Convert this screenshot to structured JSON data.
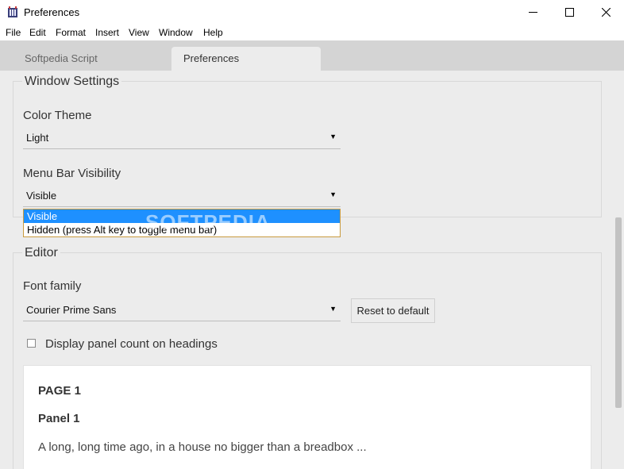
{
  "window": {
    "title": "Preferences"
  },
  "menubar": {
    "items": [
      "File",
      "Edit",
      "Format",
      "Insert",
      "View",
      "Window",
      "Help"
    ]
  },
  "tabs": [
    {
      "label": "Softpedia Script"
    },
    {
      "label": "Preferences"
    }
  ],
  "window_settings": {
    "legend": "Window Settings",
    "color_theme": {
      "label": "Color Theme",
      "value": "Light"
    },
    "menu_bar_visibility": {
      "label": "Menu Bar Visibility",
      "value": "Visible",
      "options": [
        "Visible",
        "Hidden (press Alt key to toggle menu bar)"
      ]
    }
  },
  "editor": {
    "legend": "Editor",
    "font_family": {
      "label": "Font family",
      "value": "Courier Prime Sans"
    },
    "reset_button": "Reset to default",
    "display_panel_count": {
      "label": "Display panel count on headings",
      "checked": false
    },
    "preview": {
      "page_heading": "PAGE 1",
      "panel_heading": "Panel 1",
      "text": "A long, long time ago, in a house no bigger than a breadbox ..."
    }
  },
  "watermark": "SOFTPEDIA",
  "colors": {
    "selected_option": "#1e90ff",
    "dropdown_border": "#c89a3e"
  }
}
